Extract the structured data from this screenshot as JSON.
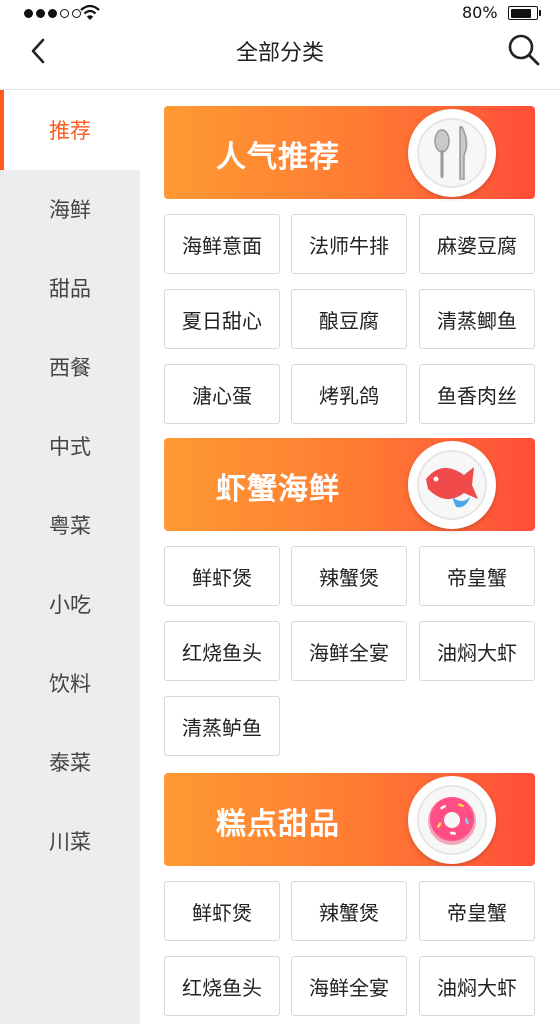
{
  "status_bar": {
    "battery_text": "80%",
    "battery_level": 0.8,
    "signal_bars": 5,
    "signal_filled": 3
  },
  "nav": {
    "title": "全部分类",
    "back_icon": "chevron-left-icon",
    "search_icon": "search-icon"
  },
  "sidebar": {
    "active_index": 0,
    "items": [
      "推荐",
      "海鲜",
      "甜品",
      "西餐",
      "中式",
      "粤菜",
      "小吃",
      "饮料",
      "泰菜",
      "川菜"
    ]
  },
  "sections": [
    {
      "title": "人气推荐",
      "icon": "spoon-knife-icon",
      "items": [
        "海鲜意面",
        "法师牛排",
        "麻婆豆腐",
        "夏日甜心",
        "酿豆腐",
        "清蒸鲫鱼",
        "溏心蛋",
        "烤乳鸽",
        "鱼香肉丝"
      ]
    },
    {
      "title": "虾蟹海鲜",
      "icon": "fish-icon",
      "items": [
        "鲜虾煲",
        "辣蟹煲",
        "帝皇蟹",
        "红烧鱼头",
        "海鲜全宴",
        "油焖大虾",
        "清蒸鲈鱼"
      ]
    },
    {
      "title": "糕点甜品",
      "icon": "donut-icon",
      "items": [
        "鲜虾煲",
        "辣蟹煲",
        "帝皇蟹",
        "红烧鱼头",
        "海鲜全宴",
        "油焖大虾"
      ]
    }
  ],
  "colors": {
    "accent": "#ff5a1f",
    "banner_start": "#ff9933",
    "banner_end": "#ff4d3a",
    "sidebar_bg": "#ededed"
  }
}
